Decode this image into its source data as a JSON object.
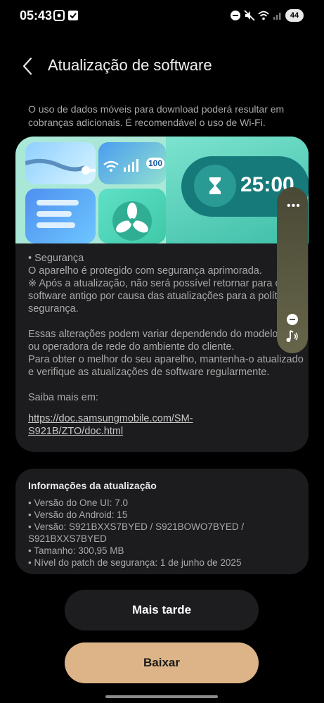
{
  "status_bar": {
    "time": "05:43",
    "battery": "44"
  },
  "header": {
    "title": "Atualização de software"
  },
  "warning_text": "O uso de dados móveis para download poderá resultar em cobranças adicionais. É recomendável o uso de Wi-Fi.",
  "banner": {
    "timer": "25:00",
    "percent": "100"
  },
  "details": {
    "body": "• Segurança\nO aparelho é protegido com segurança aprimorada.\n※ Após a atualização, não será possível retornar para o software antigo por causa das atualizações para a política de segurança.\n\nEssas alterações podem variar dependendo do modelo, país ou operadora de rede do ambiente do cliente.\nPara obter o melhor do seu aparelho, mantenha-o atualizado e verifique as atualizações de software regularmente.\n\nSaiba mais em:",
    "link": "https://doc.samsungmobile.com/SM-S921B/ZTO/doc.html"
  },
  "update_info": {
    "title": "Informações da atualização",
    "items": [
      "• Versão do One UI: 7.0",
      "• Versão do Android: 15",
      "• Versão: S921BXXS7BYED / S921BOWO7BYED /\n   S921BXXS7BYED",
      "• Tamanho: 300,95 MB",
      "• Nível do patch de segurança: 1 de junho de 2025"
    ]
  },
  "buttons": {
    "later": "Mais tarde",
    "download": "Baixar"
  }
}
